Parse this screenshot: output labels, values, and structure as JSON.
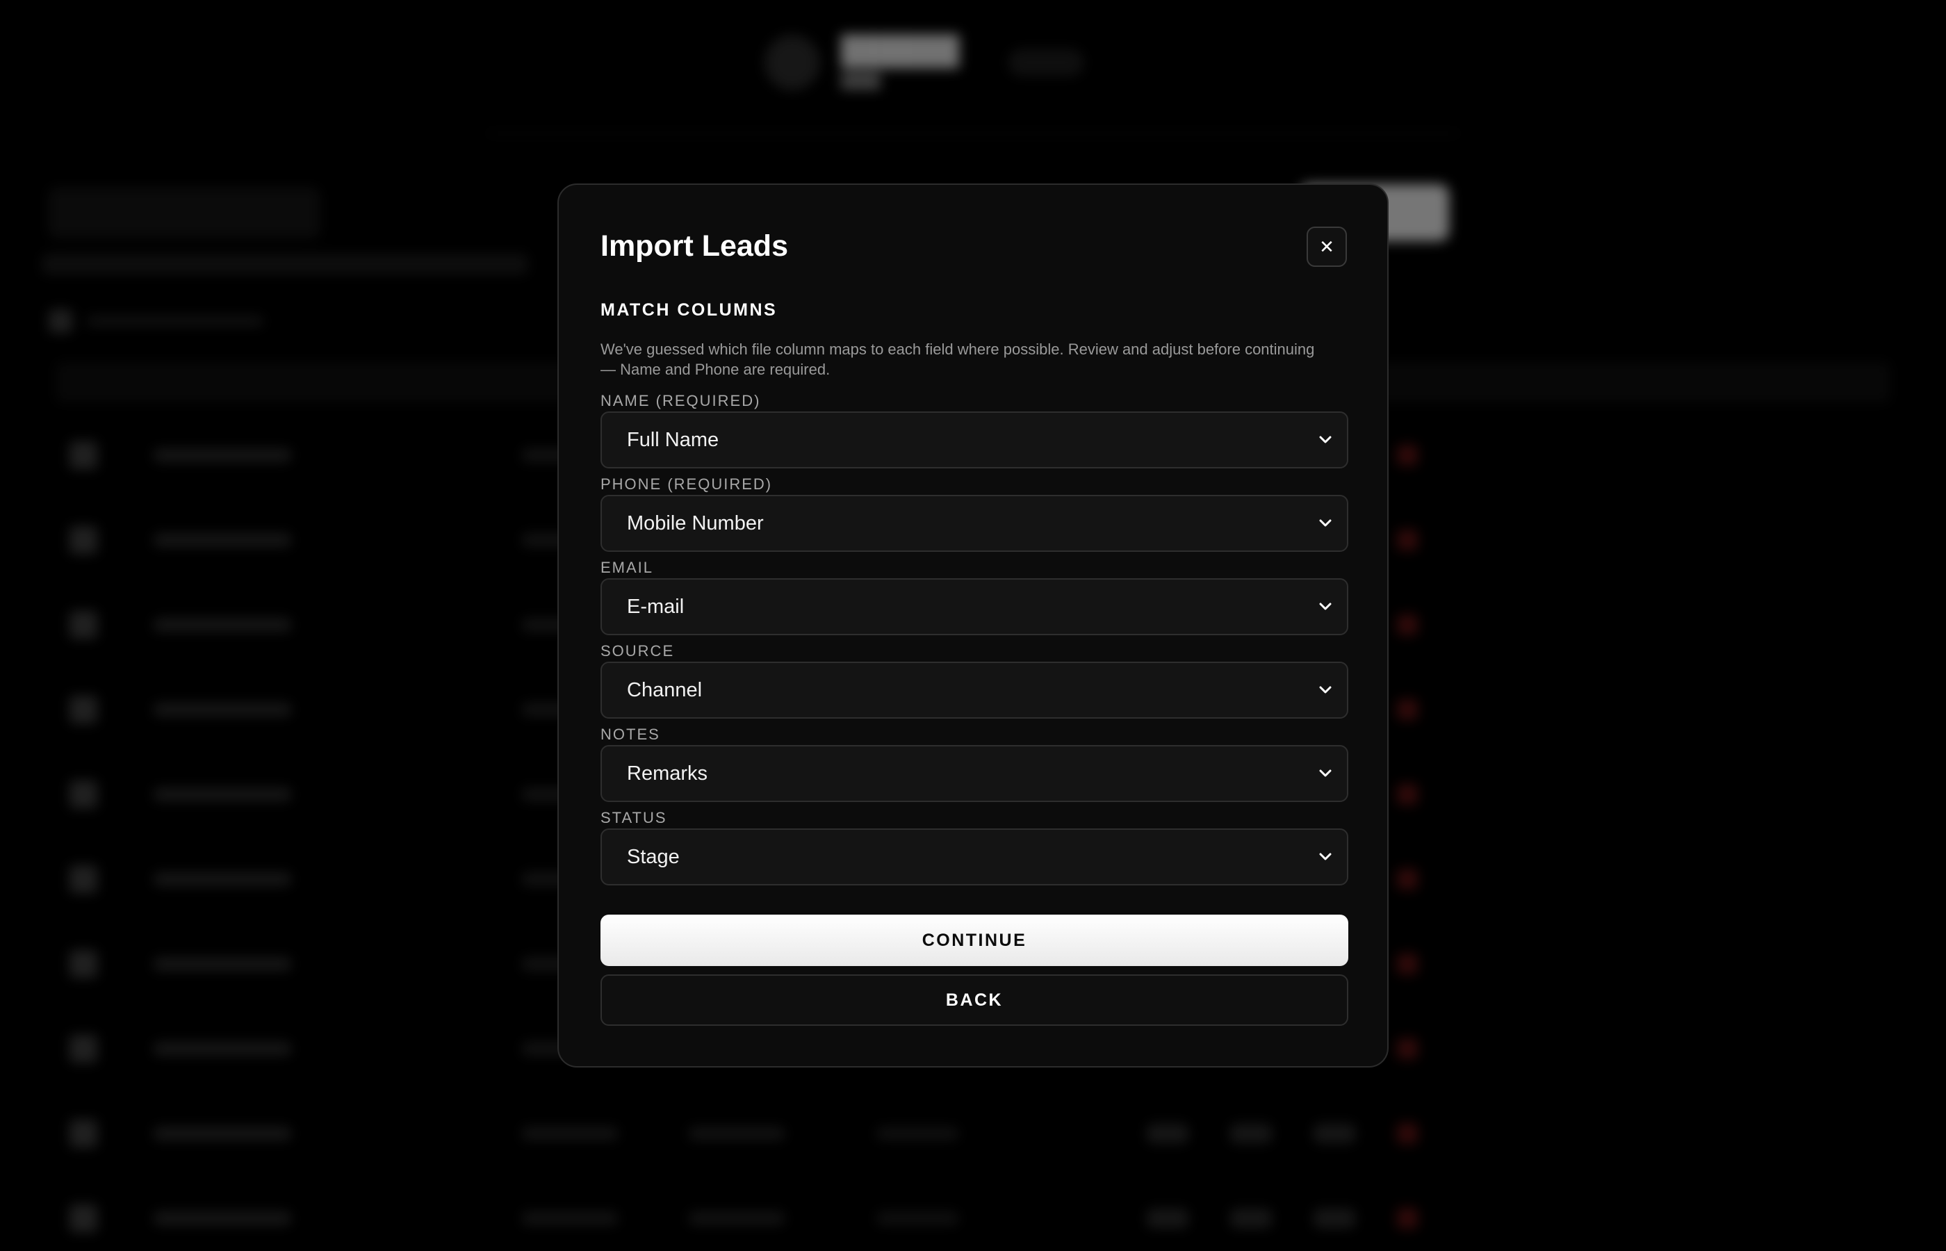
{
  "modal": {
    "title": "Import Leads",
    "close_icon": "close-icon",
    "section_title": "MATCH COLUMNS",
    "description": "We've guessed which file column maps to each field where possible. Review and adjust before continuing — Name and Phone are required.",
    "fields": [
      {
        "label": "NAME (REQUIRED)",
        "value": "Full Name"
      },
      {
        "label": "PHONE (REQUIRED)",
        "value": "Mobile Number"
      },
      {
        "label": "EMAIL",
        "value": "E-mail"
      },
      {
        "label": "SOURCE",
        "value": "Channel"
      },
      {
        "label": "NOTES",
        "value": "Remarks"
      },
      {
        "label": "STATUS",
        "value": "Stage"
      }
    ],
    "continue_label": "CONTINUE",
    "back_label": "BACK"
  },
  "colors": {
    "modal_bg": "#0c0c0c",
    "primary_button": "#ffffff",
    "delete_accent": "#5a1414"
  }
}
